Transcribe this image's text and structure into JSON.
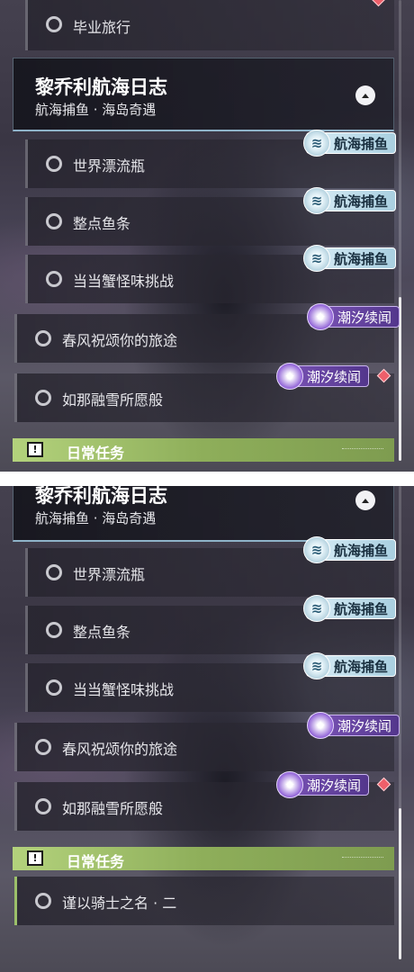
{
  "top": {
    "first_item": "毕业旅行",
    "event": {
      "title": "黎乔利航海日志",
      "subtitle": "航海捕鱼 · 海岛奇遇"
    },
    "subquests": [
      {
        "label": "世界漂流瓶",
        "tag": "航海捕鱼"
      },
      {
        "label": "整点鱼条",
        "tag": "航海捕鱼"
      },
      {
        "label": "当当蟹怪味挑战",
        "tag": "航海捕鱼"
      }
    ],
    "quests": [
      {
        "label": "春风祝颂你的旅途",
        "tag": "潮汐续闻"
      },
      {
        "label": "如那融雪所愿般",
        "tag": "潮汐续闻"
      }
    ],
    "daily_label": "日常任务",
    "daily_icon": "!"
  },
  "bottom": {
    "event": {
      "title": "黎乔利航海日志",
      "subtitle": "航海捕鱼 · 海岛奇遇"
    },
    "subquests": [
      {
        "label": "世界漂流瓶",
        "tag": "航海捕鱼"
      },
      {
        "label": "整点鱼条",
        "tag": "航海捕鱼"
      },
      {
        "label": "当当蟹怪味挑战",
        "tag": "航海捕鱼"
      }
    ],
    "quests": [
      {
        "label": "春风祝颂你的旅途",
        "tag": "潮汐续闻"
      },
      {
        "label": "如那融雪所愿般",
        "tag": "潮汐续闻"
      }
    ],
    "daily_label": "日常任务",
    "daily_icon": "!",
    "daily_quests": [
      {
        "label": "谨以骑士之名 · 二"
      }
    ]
  },
  "icons": {
    "fish_tag_icon": "fishing-wave-icon",
    "tide_tag_icon": "tide-sparkle-icon",
    "collapse": "chevron-up-icon",
    "alert": "alert-diamond-icon",
    "daily": "exclamation-box-icon"
  },
  "colors": {
    "daily_bar": "#9cc06a",
    "tide_tag": "#6b46a8",
    "fish_tag": "#c6e1ee",
    "alert_diamond": "#ee5f6a"
  }
}
